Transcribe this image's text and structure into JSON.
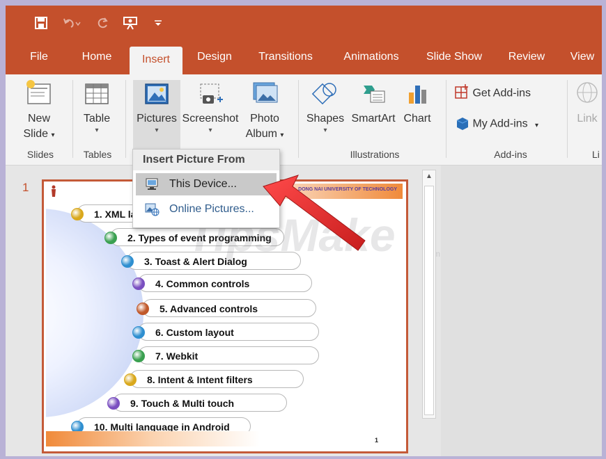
{
  "colors": {
    "accent": "#c4502c",
    "ribbon": "#f3f3f3",
    "arrow": "#e03a3a"
  },
  "qat": {
    "icons": [
      "save-icon",
      "undo-icon",
      "redo-icon",
      "present-from-start-icon",
      "customize-qat-icon"
    ]
  },
  "tabs": [
    {
      "label": "File"
    },
    {
      "label": "Home"
    },
    {
      "label": "Insert",
      "active": true
    },
    {
      "label": "Design"
    },
    {
      "label": "Transitions"
    },
    {
      "label": "Animations"
    },
    {
      "label": "Slide Show"
    },
    {
      "label": "Review"
    },
    {
      "label": "View"
    }
  ],
  "ribbon": {
    "new_slide": {
      "line1": "New",
      "line2": "Slide"
    },
    "table": {
      "label": "Table"
    },
    "pictures": {
      "label": "Pictures"
    },
    "screenshot": {
      "label": "Screenshot"
    },
    "photo_album": {
      "line1": "Photo",
      "line2": "Album"
    },
    "shapes": {
      "label": "Shapes"
    },
    "smartart": {
      "label": "SmartArt"
    },
    "chart": {
      "label": "Chart"
    },
    "get_addins": {
      "label": "Get Add-ins"
    },
    "my_addins": {
      "label": "My Add-ins"
    },
    "link": {
      "label": "Link"
    },
    "groups": {
      "slides": "Slides",
      "tables": "Tables",
      "illustrations": "Illustrations",
      "addins": "Add-ins",
      "links_partial": "Li"
    }
  },
  "dropdown": {
    "header": "Insert Picture From",
    "items": [
      {
        "label": "This Device...",
        "highlighted": true
      },
      {
        "label": "Online Pictures..."
      }
    ]
  },
  "slide": {
    "number": "1",
    "header_text": "DONG NAI UNIVERSITY OF TECHNOLOGY",
    "page_number": "1",
    "items": [
      {
        "text": "1. XML layout",
        "color": "#d9a81c"
      },
      {
        "text": "2. Types of event programming",
        "color": "#3aa050"
      },
      {
        "text": "3. Toast & Alert Dialog",
        "color": "#2f8fd0"
      },
      {
        "text": "4. Common controls",
        "color": "#7a4fc0"
      },
      {
        "text": "5. Advanced controls",
        "color": "#c0582a"
      },
      {
        "text": "6. Custom layout",
        "color": "#2f8fd0"
      },
      {
        "text": "7. Webkit",
        "color": "#3aa050"
      },
      {
        "text": "8. Intent & Intent filters",
        "color": "#d9a81c"
      },
      {
        "text": "9. Touch & Multi touch",
        "color": "#7a4fc0"
      },
      {
        "text": "10. Multi language in Android",
        "color": "#2f8fd0"
      }
    ]
  },
  "watermark": {
    "text": "TipsMake",
    "suffix": ".com"
  }
}
